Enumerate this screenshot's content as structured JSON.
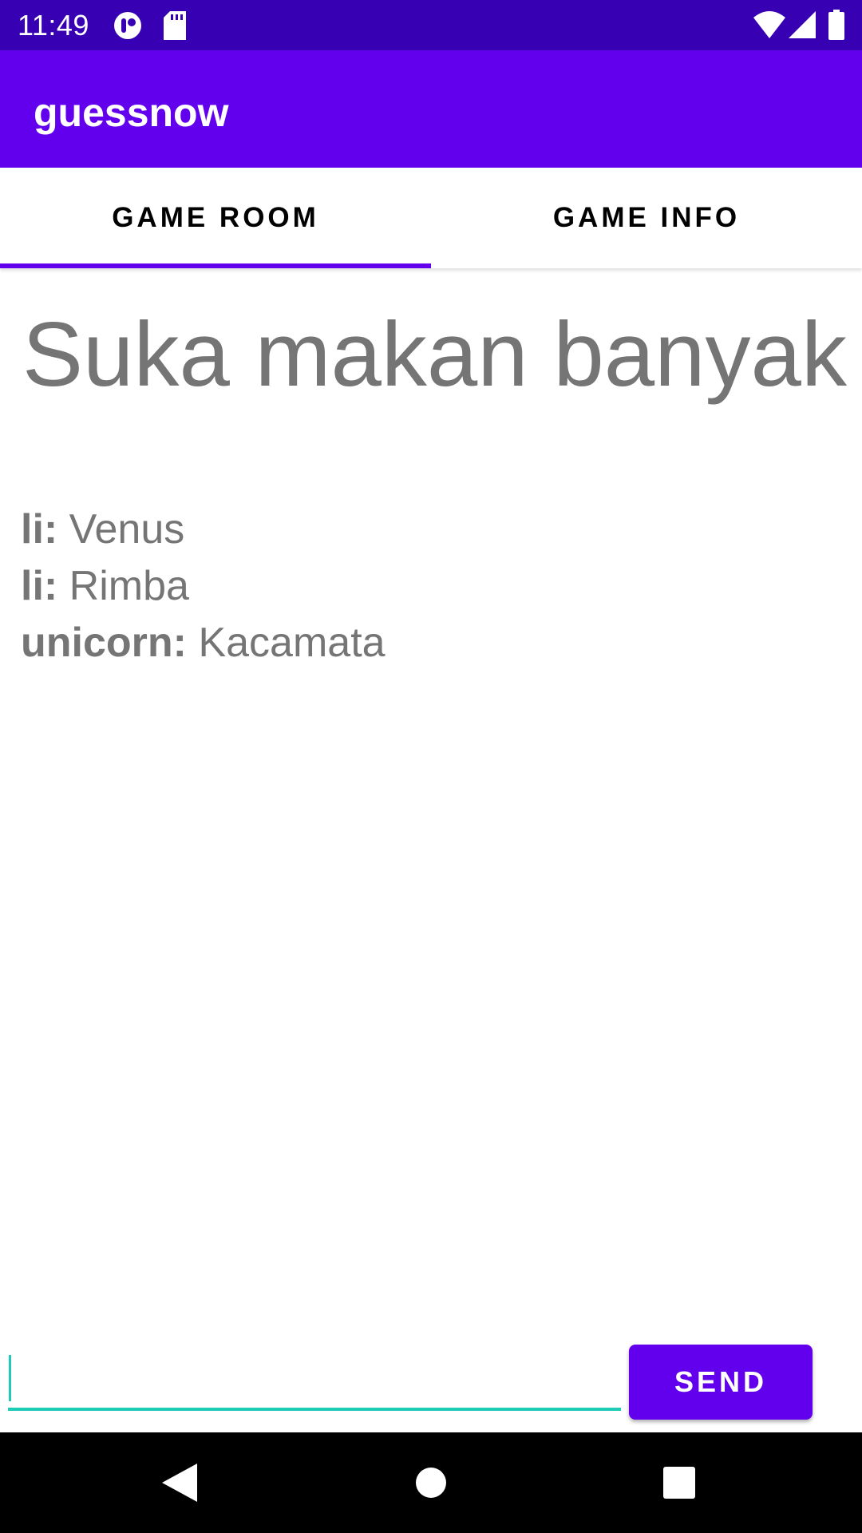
{
  "status_bar": {
    "time": "11:49",
    "icons": [
      "notification-icon",
      "sd-card-icon",
      "wifi-icon",
      "signal-icon",
      "battery-icon"
    ]
  },
  "app_bar": {
    "title": "guessnow"
  },
  "tabs": [
    {
      "label": "GAME ROOM",
      "selected": true
    },
    {
      "label": "GAME INFO",
      "selected": false
    }
  ],
  "game": {
    "hint": "Suka makan banyak",
    "messages": [
      {
        "sender": "li:",
        "text": "Venus"
      },
      {
        "sender": "li:",
        "text": "Rimba"
      },
      {
        "sender": "unicorn:",
        "text": "Kacamata"
      }
    ]
  },
  "input": {
    "value": "",
    "placeholder": ""
  },
  "send_button": {
    "label": "SEND"
  },
  "nav_bar": {
    "icons": [
      "back-icon",
      "home-icon",
      "recents-icon"
    ]
  },
  "colors": {
    "status_bar": "#3700b3",
    "primary": "#6200ee",
    "accent": "#1ecbb5",
    "text_secondary": "#757575"
  }
}
